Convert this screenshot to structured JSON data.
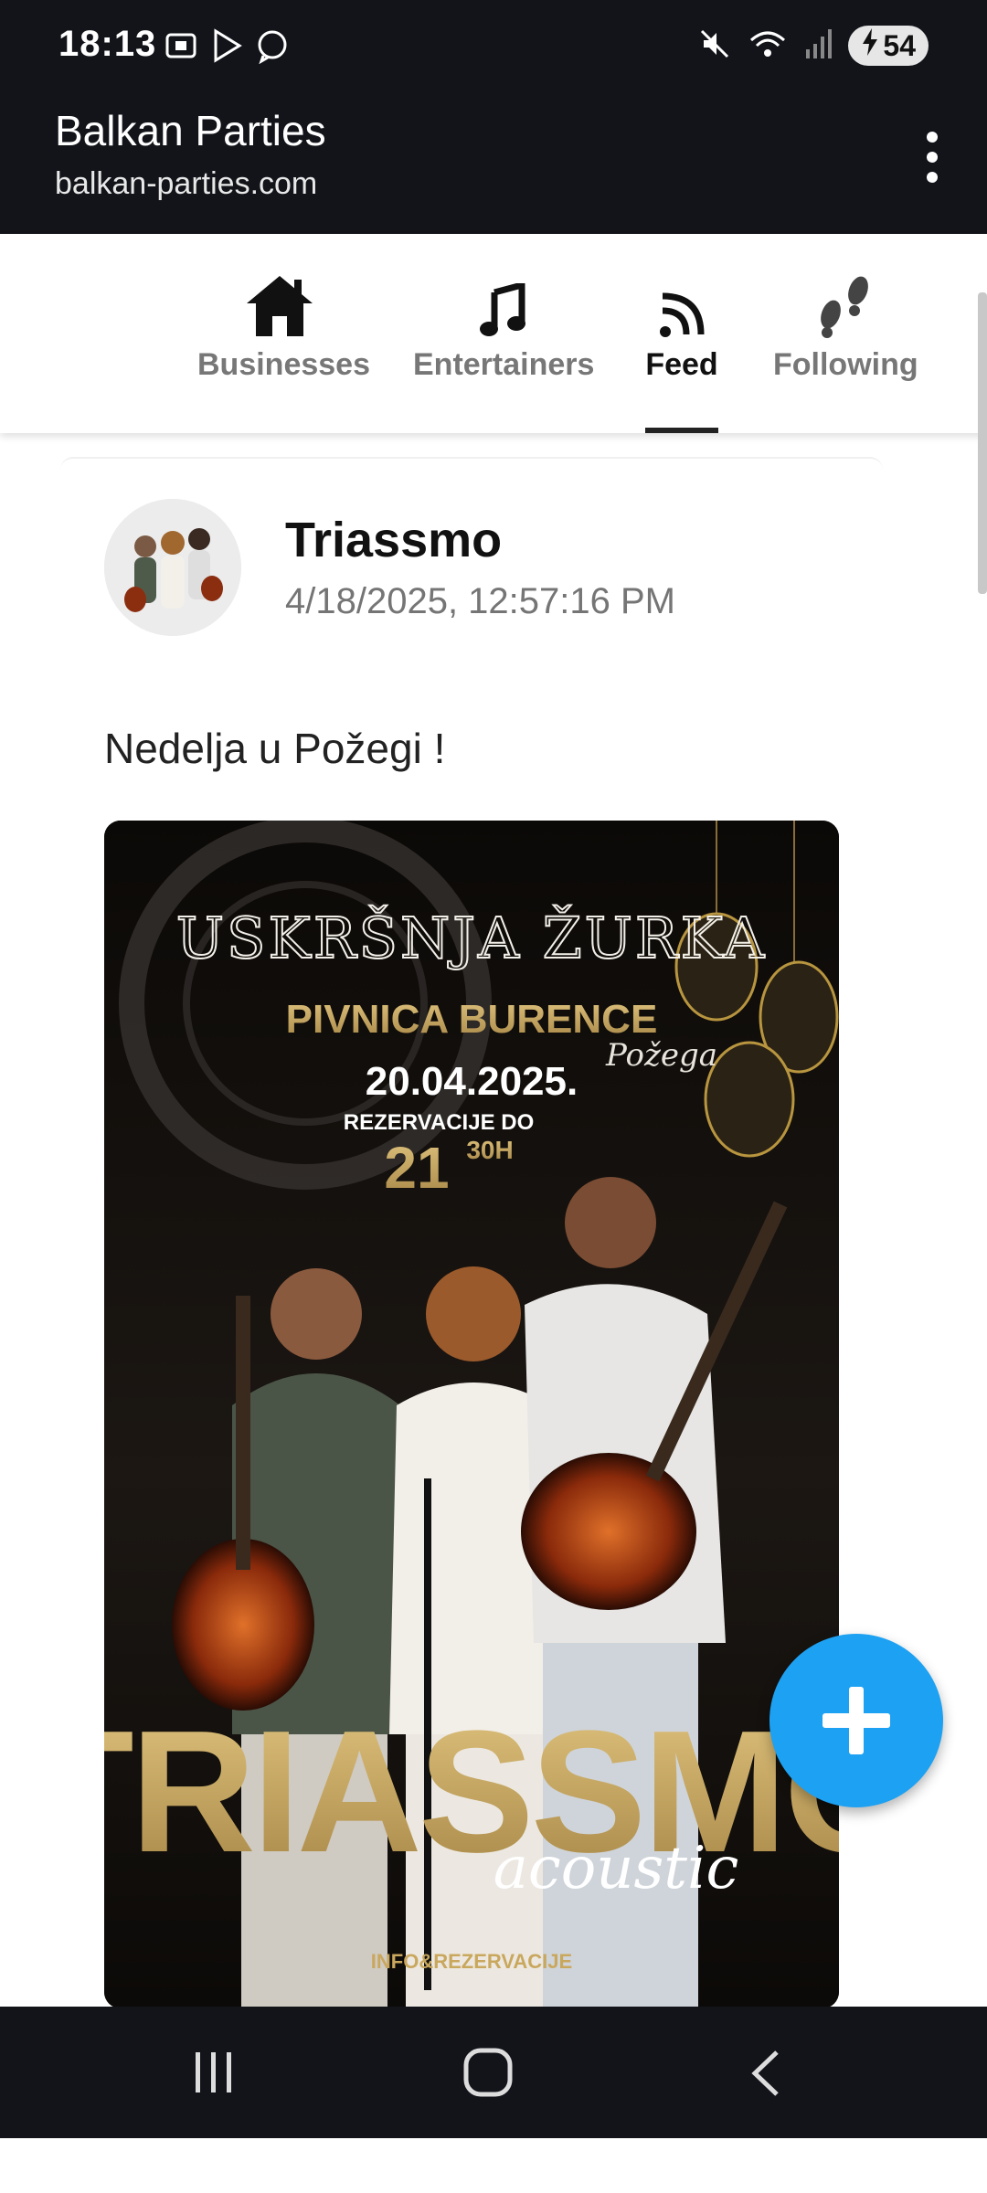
{
  "status_bar": {
    "time": "18:13",
    "battery": "54",
    "icons": [
      "screenshot-icon",
      "play-store-icon",
      "viber-icon",
      "mute-icon",
      "wifi-icon",
      "signal-icon",
      "battery-charging-icon"
    ]
  },
  "header": {
    "title": "Balkan Parties",
    "url": "balkan-parties.com",
    "menu_icon": "more-vert-icon"
  },
  "nav_tabs": [
    {
      "label": "Businesses",
      "icon": "house-icon",
      "active": false
    },
    {
      "label": "Entertainers",
      "icon": "music-note-icon",
      "active": false
    },
    {
      "label": "Feed",
      "icon": "rss-icon",
      "active": true
    },
    {
      "label": "Following",
      "icon": "footprints-icon",
      "active": false
    }
  ],
  "post": {
    "author": "Triassmo",
    "date": "4/18/2025, 12:57:16 PM",
    "text": "Nedelja u Požegi !",
    "poster": {
      "event_title": "USKRŠNJA ŽURKA",
      "venue": "PIVNICA BURENCE",
      "venue_city": "Požega",
      "date": "20.04.2025.",
      "reservations": "REZERVACIJE DO",
      "time_hour": "21",
      "time_minutes": "30H",
      "band": "TRIASSMO",
      "band_sub": "acoustic",
      "info": "INFO&REZERVACIJE"
    }
  },
  "fab": {
    "icon": "plus-icon"
  },
  "system_nav": [
    "recent-apps-icon",
    "home-icon",
    "back-icon"
  ],
  "colors": {
    "bar_bg": "#12141a",
    "fab": "#1da1f2",
    "gold": "#c9a75d"
  }
}
